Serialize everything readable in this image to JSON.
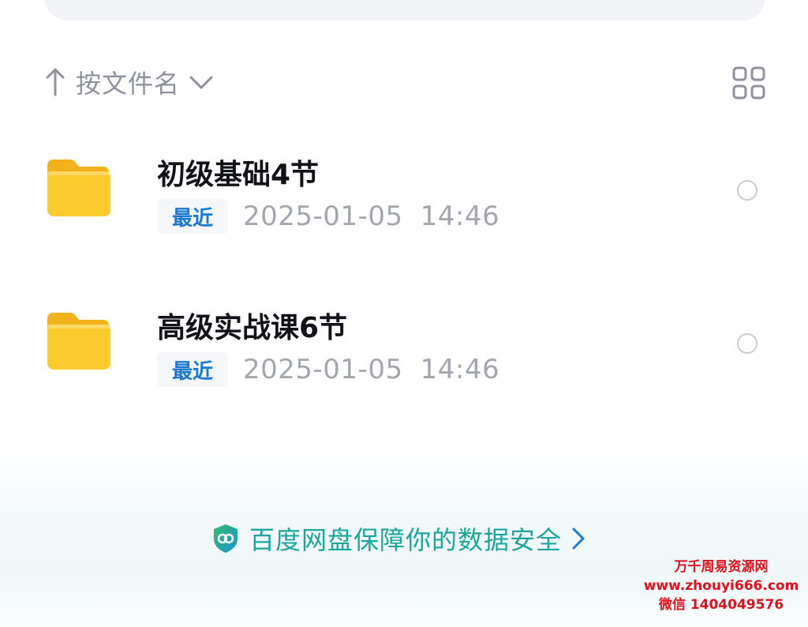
{
  "sort": {
    "label": "按文件名"
  },
  "files": [
    {
      "name": "初级基础4节",
      "badge": "最近",
      "date": "2025-01-05",
      "time": "14:46"
    },
    {
      "name": "高级实战课6节",
      "badge": "最近",
      "date": "2025-01-05",
      "time": "14:46"
    }
  ],
  "security": {
    "text": "百度网盘保障你的数据安全"
  },
  "watermark": {
    "line1": "万千周易资源网",
    "line2": "www.zhouyi666.com",
    "line3": "微信 1404049576"
  },
  "colors": {
    "accent_blue": "#1d78d4",
    "security_teal": "#1aa69a",
    "folder_yellow": "#f7c324",
    "watermark_red": "#e0101c"
  },
  "icons": [
    "sort-arrow-up-icon",
    "chevron-down-icon",
    "grid-view-icon",
    "folder-icon",
    "shield-icon",
    "chevron-right-icon"
  ]
}
